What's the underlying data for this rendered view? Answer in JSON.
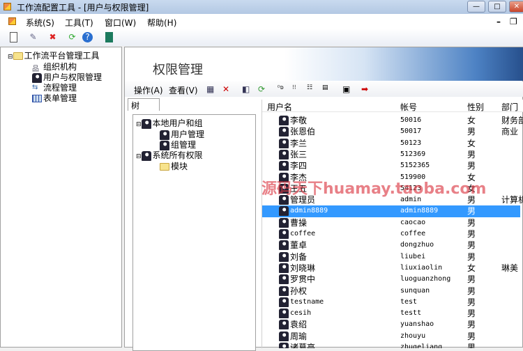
{
  "window": {
    "title": "工作流配置工具 - [用户与权限管理]",
    "min": "—",
    "max": "□",
    "close": "✕"
  },
  "menu": [
    "系统(S)",
    "工具(T)",
    "窗口(W)",
    "帮助(H)"
  ],
  "mdi": {
    "min": "–",
    "restore": "❐"
  },
  "left_tree": {
    "root": "工作流平台管理工具",
    "items": [
      "组织机构",
      "用户与权限管理",
      "流程管理",
      "表单管理"
    ]
  },
  "panel": {
    "title": "权限管理",
    "menu": [
      "操作(A)",
      "查看(V)"
    ],
    "tab": "树"
  },
  "perm_tree": {
    "group1": "本地用户和组",
    "group1_items": [
      "用户管理",
      "组管理"
    ],
    "group2": "系统所有权限",
    "group2_items": [
      "模块"
    ]
  },
  "list": {
    "headers": [
      "用户名",
      "帐号",
      "性别",
      "部门"
    ],
    "rows": [
      {
        "name": "李敬",
        "account": "50016",
        "gender": "女",
        "dept": "财务部"
      },
      {
        "name": "张恩伯",
        "account": "50017",
        "gender": "男",
        "dept": "商业"
      },
      {
        "name": "李兰",
        "account": "50123",
        "gender": "女",
        "dept": ""
      },
      {
        "name": "张三",
        "account": "512369",
        "gender": "男",
        "dept": ""
      },
      {
        "name": "李四",
        "account": "5152365",
        "gender": "男",
        "dept": ""
      },
      {
        "name": "李杰",
        "account": "519900",
        "gender": "女",
        "dept": ""
      },
      {
        "name": "王五",
        "account": "54123",
        "gender": "女",
        "dept": ""
      },
      {
        "name": "管理员",
        "account": "admin",
        "gender": "男",
        "dept": "计算机"
      },
      {
        "name": "admin8889",
        "account": "admin8889",
        "gender": "男",
        "dept": "",
        "selected": true
      },
      {
        "name": "曹操",
        "account": "caocao",
        "gender": "男",
        "dept": ""
      },
      {
        "name": "coffee",
        "account": "coffee",
        "gender": "男",
        "dept": ""
      },
      {
        "name": "董卓",
        "account": "dongzhuo",
        "gender": "男",
        "dept": ""
      },
      {
        "name": "刘备",
        "account": "liubei",
        "gender": "男",
        "dept": ""
      },
      {
        "name": "刘晓琳",
        "account": "liuxiaolin",
        "gender": "女",
        "dept": "琳美"
      },
      {
        "name": "罗贯中",
        "account": "luoguanzhong",
        "gender": "男",
        "dept": ""
      },
      {
        "name": "孙权",
        "account": "sunquan",
        "gender": "男",
        "dept": ""
      },
      {
        "name": "testname",
        "account": "test",
        "gender": "男",
        "dept": ""
      },
      {
        "name": "cesih",
        "account": "testt",
        "gender": "男",
        "dept": ""
      },
      {
        "name": "袁绍",
        "account": "yuanshao",
        "gender": "男",
        "dept": ""
      },
      {
        "name": "周瑜",
        "account": "zhouyu",
        "gender": "男",
        "dept": ""
      },
      {
        "name": "诸葛亮",
        "account": "zhugeliang",
        "gender": "男",
        "dept": ""
      }
    ]
  },
  "watermark": "源码天下huamay.taoba.com"
}
